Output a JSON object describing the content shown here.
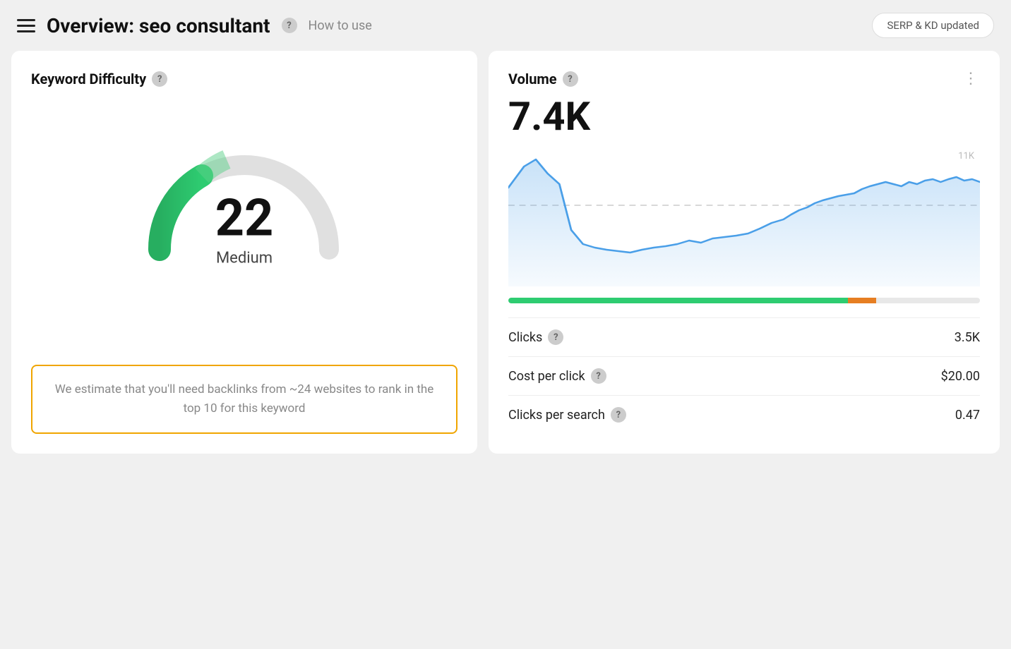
{
  "header": {
    "title": "Overview: seo consultant",
    "how_to_use": "How to use",
    "serp_badge": "SERP & KD updated"
  },
  "kd_card": {
    "title": "Keyword Difficulty",
    "score": "22",
    "label": "Medium",
    "estimate": "We estimate that you'll need backlinks from ~24 websites to rank in the top 10 for this keyword"
  },
  "volume_card": {
    "title": "Volume",
    "value": "7.4K",
    "y_label": "11K",
    "metrics": [
      {
        "label": "Clicks",
        "value": "3.5K"
      },
      {
        "label": "Cost per click",
        "value": "$20.00"
      },
      {
        "label": "Clicks per search",
        "value": "0.47"
      }
    ]
  },
  "icons": {
    "help": "?",
    "more": "⋮"
  }
}
